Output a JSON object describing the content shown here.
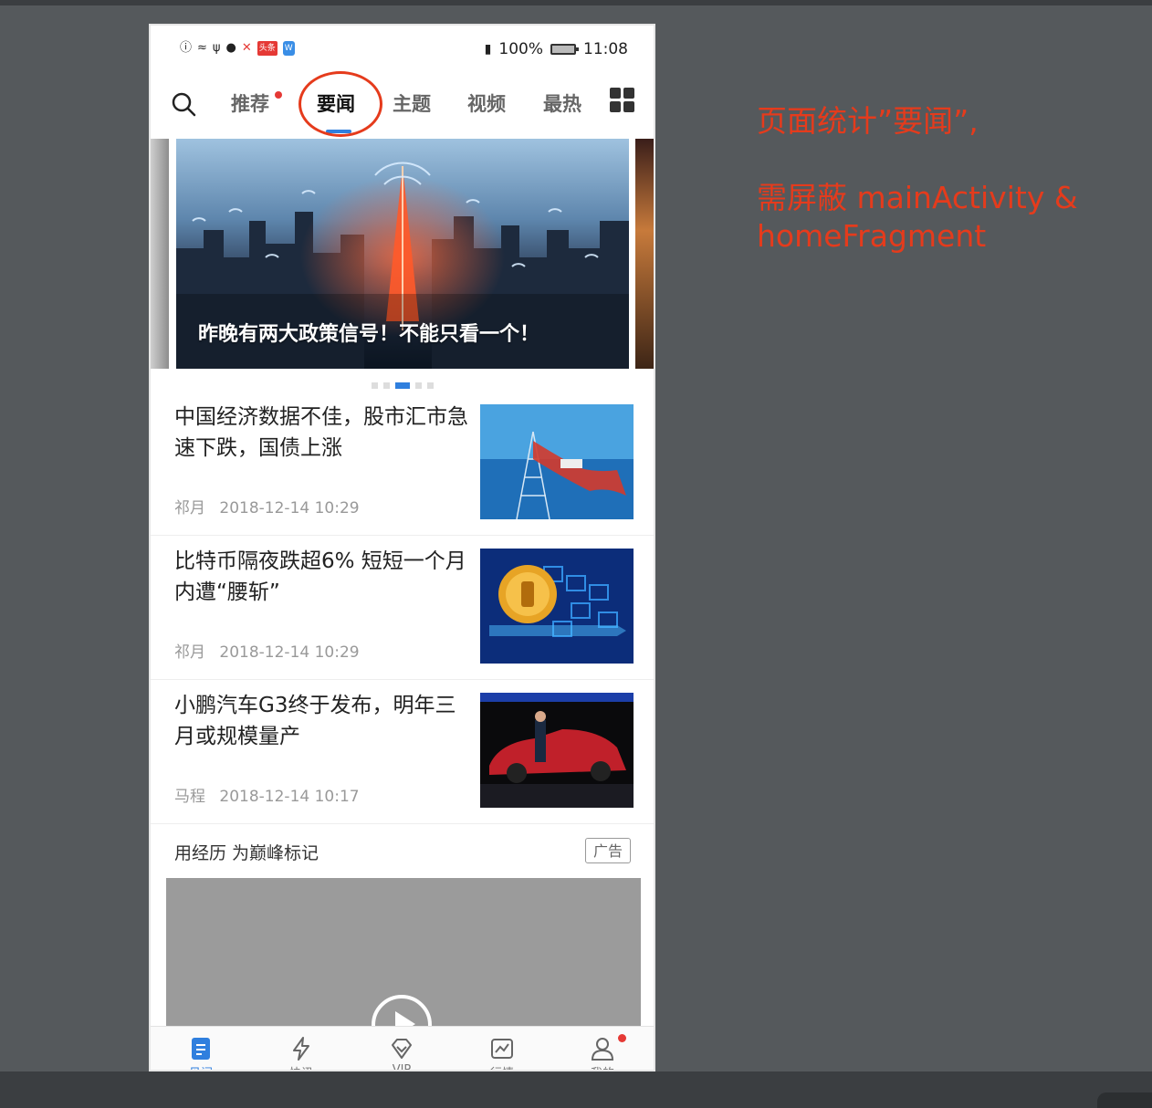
{
  "status_bar": {
    "battery_percent": "100%",
    "time": "11:08",
    "badge_toutiao": "头条",
    "badge_app": "W"
  },
  "tabs": [
    {
      "label": "推荐",
      "has_dot": true
    },
    {
      "label": "要闻",
      "active": true
    },
    {
      "label": "主题"
    },
    {
      "label": "视频"
    },
    {
      "label": "最热"
    }
  ],
  "banner": {
    "title": "昨晚有两大政策信号！不能只看一个！",
    "slide_count": 5,
    "active_slide": 3
  },
  "articles": [
    {
      "title": "中国经济数据不佳，股市汇市急速下跌，国债上涨",
      "author": "祁月",
      "time": "2018-12-14 10:29"
    },
    {
      "title": "比特币隔夜跌超6% 短短一个月内遭“腰斩”",
      "author": "祁月",
      "time": "2018-12-14 10:29"
    },
    {
      "title": "小鹏汽车G3终于发布，明年三月或规模量产",
      "author": "马程",
      "time": "2018-12-14 10:17"
    }
  ],
  "ad": {
    "title": "用经历 为巅峰标记",
    "badge": "广告"
  },
  "bottom_nav": [
    {
      "label": "见闻",
      "icon": "news-icon",
      "active": true
    },
    {
      "label": "快讯",
      "icon": "lightning-icon"
    },
    {
      "label": "VIP",
      "icon": "diamond-icon"
    },
    {
      "label": "行情",
      "icon": "chart-icon"
    },
    {
      "label": "我的",
      "icon": "user-icon",
      "has_dot": true
    }
  ],
  "annotation": {
    "line1": "页面统计”要闻”,",
    "line2": "需屏蔽 mainActivity &",
    "line3": "homeFragment"
  },
  "colors": {
    "accent": "#2f7fde",
    "annotation_red": "#e53b1c",
    "badge_red": "#e53935"
  }
}
